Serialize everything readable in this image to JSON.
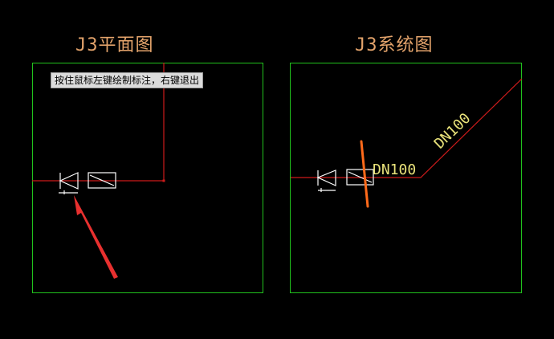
{
  "view_titles": {
    "plan": "J3平面图",
    "system": "J3系统图"
  },
  "tooltip": {
    "text": "按住鼠标左键绘制标注，右键退出"
  },
  "labels": {
    "horizontal_pipe": "DN100",
    "diagonal_pipe": "DN100"
  },
  "colors": {
    "background": "#000000",
    "frame": "#21c21d",
    "pipe": "#cc1b1b",
    "symbol": "#ffffff",
    "title": "#e3a36b",
    "label": "#e9e27a",
    "annotation_stroke": "#ff6a1a",
    "arrow": "#e8302f"
  },
  "icons": {
    "check_valve": "check-valve-icon",
    "meter": "water-meter-icon",
    "annotation_arrow": "red-arrow-icon"
  }
}
